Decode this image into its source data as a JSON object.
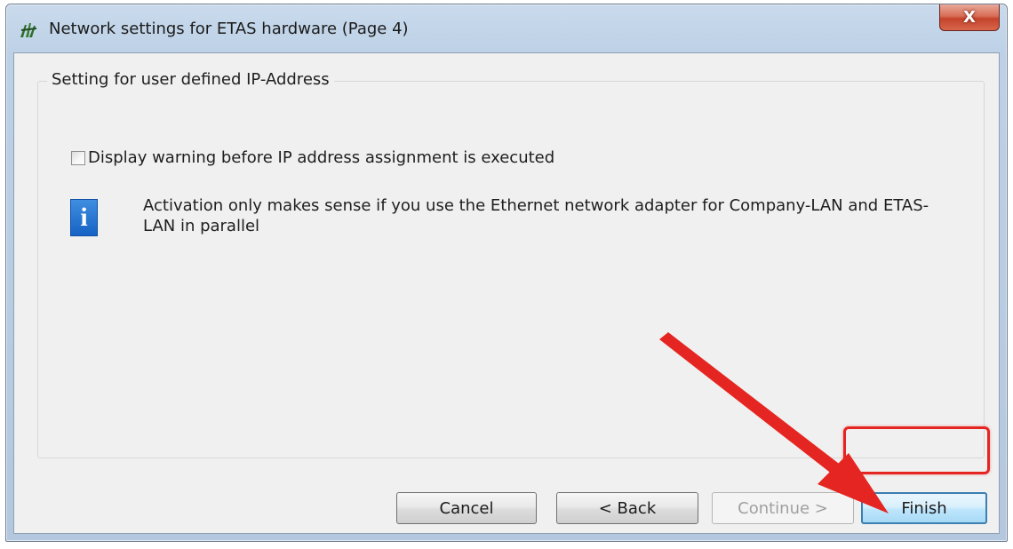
{
  "window": {
    "title": "Network settings for ETAS hardware (Page 4)",
    "close_symbol": "X"
  },
  "group": {
    "legend": "Setting for user defined IP-Address"
  },
  "checkbox": {
    "label": "Display warning before IP address assignment is executed",
    "checked": false
  },
  "info": {
    "icon_symbol": "i",
    "text": "Activation only makes sense if you use the Ethernet network adapter for Company-LAN and ETAS-LAN in parallel"
  },
  "buttons": {
    "cancel": "Cancel",
    "back": "< Back",
    "continue": "Continue >",
    "finish": "Finish"
  },
  "icons": {
    "app": "etas-app-icon",
    "close": "close-icon",
    "info": "info-icon",
    "annotation": "red-arrow-icon"
  },
  "colors": {
    "annotation_red": "#e52521",
    "info_blue": "#1762c4",
    "dialog_bg": "#f0f0f0"
  }
}
